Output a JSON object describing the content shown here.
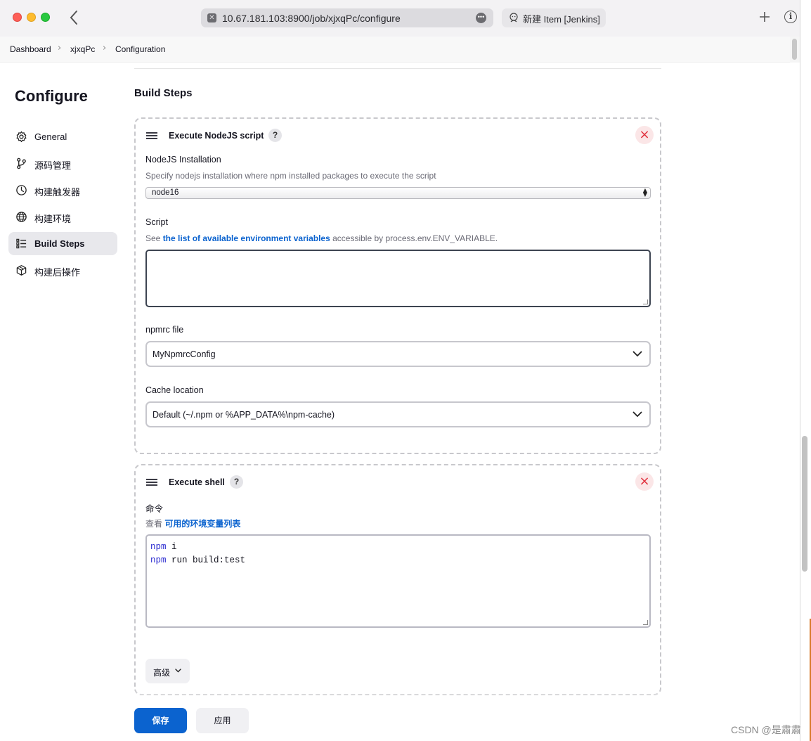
{
  "browser": {
    "url": "10.67.181.103:8900/job/xjxqPc/configure",
    "second_tab_title": "新建 Item [Jenkins]"
  },
  "breadcrumb": [
    "Dashboard",
    "xjxqPc",
    "Configuration"
  ],
  "sidebar": {
    "title": "Configure",
    "items": [
      {
        "label": "General",
        "icon": "gear-icon",
        "active": false
      },
      {
        "label": "源码管理",
        "icon": "branch-icon",
        "active": false
      },
      {
        "label": "构建触发器",
        "icon": "clock-icon",
        "active": false
      },
      {
        "label": "构建环境",
        "icon": "globe-icon",
        "active": false
      },
      {
        "label": "Build Steps",
        "icon": "list-icon",
        "active": true
      },
      {
        "label": "构建后操作",
        "icon": "cube-icon",
        "active": false
      }
    ]
  },
  "main": {
    "section_title": "Build Steps",
    "nodejs_step": {
      "title": "Execute NodeJS script",
      "help": "?",
      "close": "×",
      "installation_label": "NodeJS Installation",
      "installation_desc": "Specify nodejs installation where npm installed packages to execute the script",
      "installation_value": "node16",
      "script_label": "Script",
      "script_desc_prefix": "See ",
      "script_desc_link": "the list of available environment variables",
      "script_desc_suffix": " accessible by process.env.ENV_VARIABLE.",
      "script_value": "",
      "npmrc_label": "npmrc file",
      "npmrc_value": "MyNpmrcConfig",
      "cache_label": "Cache location",
      "cache_value": "Default (~/.npm or %APP_DATA%\\npm-cache)"
    },
    "shell_step": {
      "title": "Execute shell",
      "help": "?",
      "close": "×",
      "command_label": "命令",
      "command_desc_prefix": "查看 ",
      "command_desc_link": "可用的环境变量列表",
      "command_lines": [
        {
          "keyword": "npm",
          "rest": " i"
        },
        {
          "keyword": "npm",
          "rest": " run build:test"
        }
      ],
      "advanced_label": "高级"
    }
  },
  "footer": {
    "save_label": "保存",
    "apply_label": "应用"
  },
  "watermark": "CSDN @是肅肅",
  "colors": {
    "primary": "#0b63cf",
    "danger": "#e0303d",
    "active_nav": "#e8e8ec"
  }
}
